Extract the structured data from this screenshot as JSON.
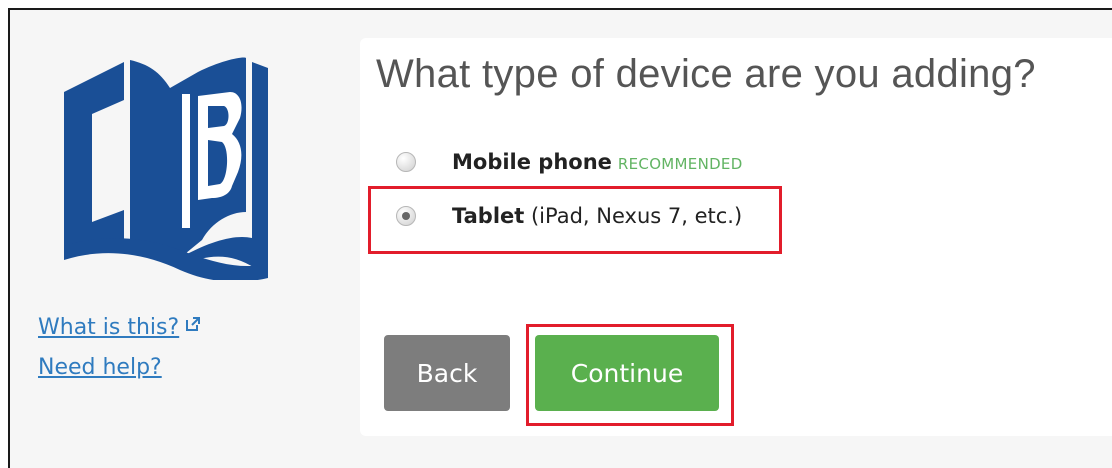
{
  "prompt": {
    "title": "What type of device are you adding?"
  },
  "options": [
    {
      "label": "Mobile phone",
      "badge": "RECOMMENDED",
      "sub": "",
      "selected": false
    },
    {
      "label": "Tablet",
      "badge": "",
      "sub": " (iPad, Nexus 7, etc.)",
      "selected": true
    }
  ],
  "links": {
    "what_is_this": "What is this?",
    "need_help": "Need help?"
  },
  "buttons": {
    "back": "Back",
    "continue": "Continue"
  },
  "icons": {
    "logo": "book-logo",
    "external": "external-link-icon"
  },
  "colors": {
    "brand_blue": "#1a4f96",
    "link": "#2f7bbf",
    "continue": "#5ab04e",
    "back": "#7d7d7d",
    "badge": "#62b463",
    "highlight": "#e21d2b"
  }
}
